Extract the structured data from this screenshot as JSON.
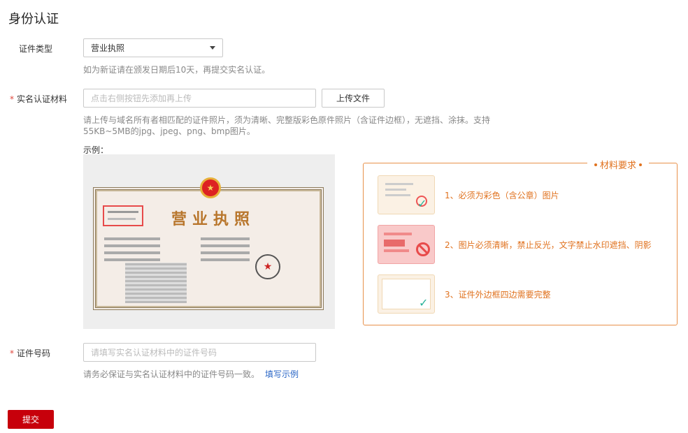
{
  "page": {
    "title": "身份认证"
  },
  "cert_type": {
    "label": "证件类型",
    "value": "营业执照",
    "help": "如为新证请在颁发日期后10天，再提交实名认证。"
  },
  "material": {
    "required_mark": "*",
    "label": "实名认证材料",
    "placeholder": "点击右侧按钮先添加再上传",
    "upload_button": "上传文件",
    "help_line1": "请上传与域名所有者相匹配的证件照片，须为清晰、完整版彩色原件照片（含证件边框），无遮挡、涂抹。支持",
    "help_line2": "55KB~5MB的jpg、jpeg、png、bmp图片。",
    "example_label": "示例：",
    "license_title": "营业执照"
  },
  "requirements": {
    "title": "材料要求",
    "items": [
      {
        "text": "1、必须为彩色（含公章）图片"
      },
      {
        "text": "2、图片必须清晰，禁止反光，文字禁止水印遮挡、阴影"
      },
      {
        "text": "3、证件外边框四边需要完整"
      }
    ]
  },
  "cert_number": {
    "required_mark": "*",
    "label": "证件号码",
    "placeholder": "请填写实名认证材料中的证件号码",
    "help": "请务必保证与实名认证材料中的证件号码一致。",
    "link": "填写示例"
  },
  "submit": {
    "label": "提交"
  },
  "colors": {
    "accent": "#c7000b",
    "orange": "#e0721f",
    "link": "#2a66c6",
    "required": "#e0483e"
  }
}
